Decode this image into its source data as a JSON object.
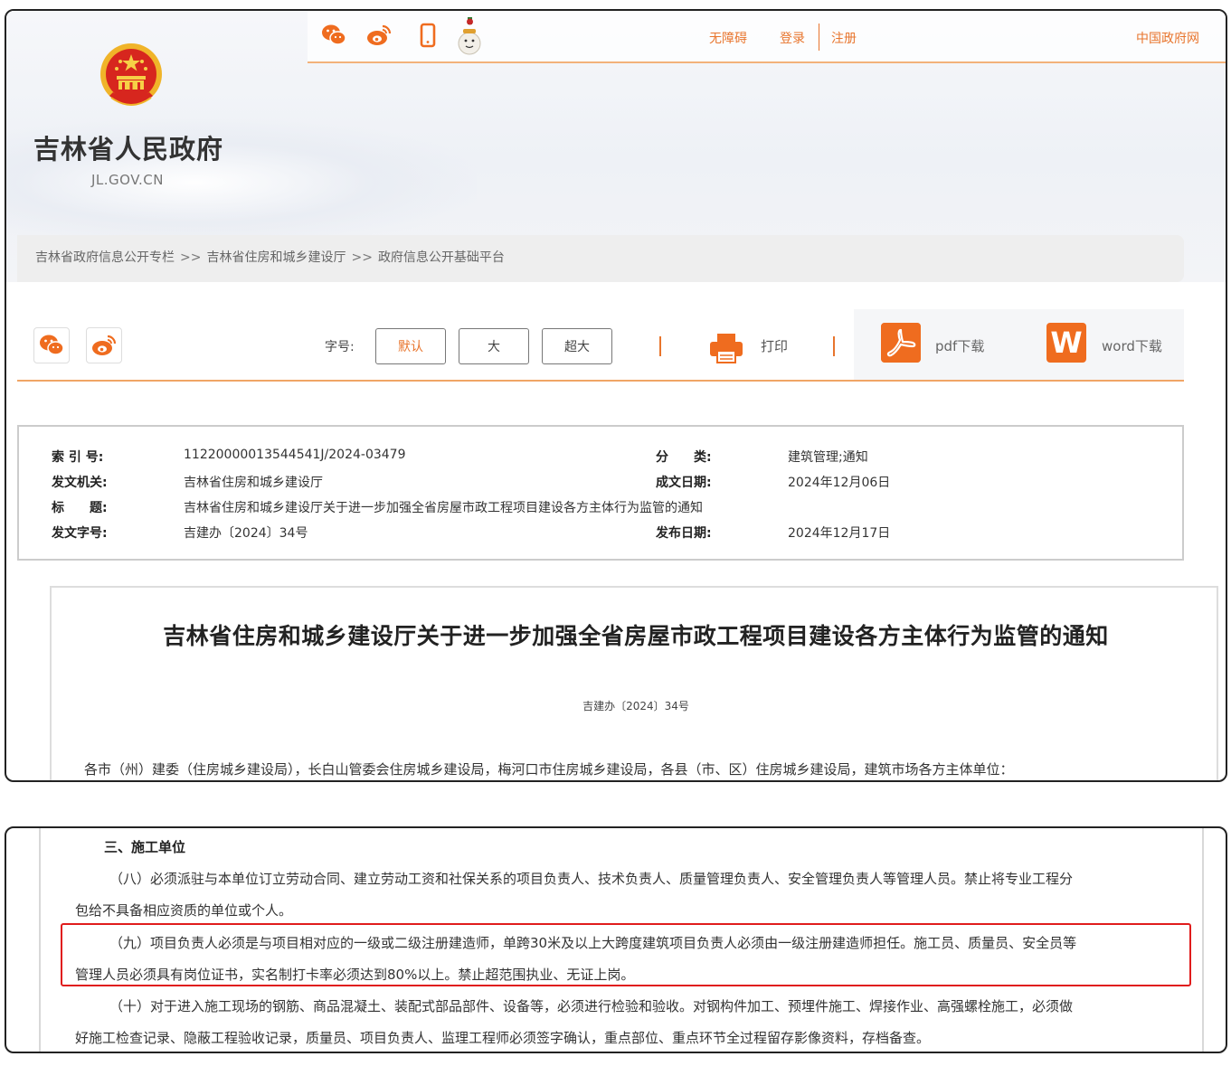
{
  "header": {
    "site_name": "吉林省人民政府",
    "site_domain": "JL.GOV.CN",
    "top_links": {
      "accessibility": "无障碍",
      "login": "登录",
      "register": "注册",
      "gov_portal": "中国政府网"
    },
    "top_icons": [
      "wechat-icon",
      "weibo-icon",
      "mobile-icon",
      "mascot-icon"
    ]
  },
  "breadcrumb": {
    "items": [
      "吉林省政府信息公开专栏",
      "吉林省住房和城乡建设厅",
      "政府信息公开基础平台"
    ],
    "separator": ">>"
  },
  "toolbar": {
    "font_label": "字号:",
    "font_sizes": [
      "默认",
      "大",
      "超大"
    ],
    "active_font_size": "默认",
    "print_label": "打印",
    "pdf_label": "pdf下载",
    "word_label": "word下载",
    "word_icon_letter": "W",
    "accent_color": "#ef6c1f"
  },
  "info": {
    "index_label": "索 引 号:",
    "index_value": "11220000013544541J/2024-03479",
    "category_label": "分　　类:",
    "category_value": "建筑管理;通知",
    "issuer_label": "发文机关:",
    "issuer_value": "吉林省住房和城乡建设厅",
    "written_date_label": "成文日期:",
    "written_date_value": "2024年12月06日",
    "title_label": "标　　题:",
    "title_value": "吉林省住房和城乡建设厅关于进一步加强全省房屋市政工程项目建设各方主体行为监管的通知",
    "doc_no_label": "发文字号:",
    "doc_no_value": "吉建办〔2024〕34号",
    "publish_date_label": "发布日期:",
    "publish_date_value": "2024年12月17日"
  },
  "document": {
    "title": "吉林省住房和城乡建设厅关于进一步加强全省房屋市政工程项目建设各方主体行为监管的通知",
    "ref": "吉建办〔2024〕34号",
    "addressees": "各市（州）建委（住房城乡建设局），长白山管委会住房城乡建设局，梅河口市住房城乡建设局，各县（市、区）住房城乡建设局，建筑市场各方主体单位："
  },
  "excerpt": {
    "section_heading": "三、施工单位",
    "p8_line1": "（八）必须派驻与本单位订立劳动合同、建立劳动工资和社保关系的项目负责人、技术负责人、质量管理负责人、安全管理负责人等管理人员。禁止将专业工程分",
    "p8_line2": "包给不具备相应资质的单位或个人。",
    "p9_line1": "（九）项目负责人必须是与项目相对应的一级或二级注册建造师，单跨30米及以上大跨度建筑项目负责人必须由一级注册建造师担任。施工员、质量员、安全员等",
    "p9_line2": "管理人员必须具有岗位证书，实名制打卡率必须达到80%以上。禁止超范围执业、无证上岗。",
    "p10_line1": "（十）对于进入施工现场的钢筋、商品混凝土、装配式部品部件、设备等，必须进行检验和验收。对钢构件加工、预埋件施工、焊接作业、高强螺栓施工，必须做",
    "p10_line2": "好施工检查记录、隐蔽工程验收记录，质量员、项目负责人、监理工程师必须签字确认，重点部位、重点环节全过程留存影像资料，存档备查。",
    "highlight_color": "#e01c1c"
  }
}
